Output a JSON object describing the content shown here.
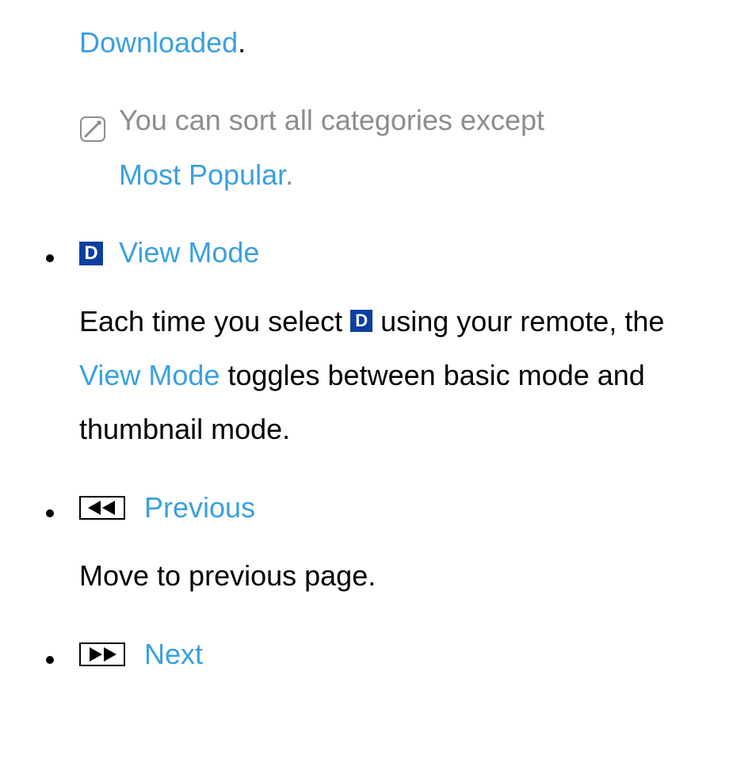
{
  "top": {
    "downloaded": "Downloaded",
    "period": "."
  },
  "note": {
    "text_before": "You can sort all categories except",
    "most_popular": "Most Popular",
    "period": "."
  },
  "viewmode": {
    "d_letter": "D",
    "title": "View Mode",
    "body_part1": "Each time you select ",
    "body_part2": " using your remote, the ",
    "view_mode_inline": "View Mode",
    "body_part3": " toggles between basic mode and thumbnail mode."
  },
  "previous": {
    "title": "Previous",
    "body": "Move to previous page."
  },
  "next": {
    "title": "Next"
  }
}
